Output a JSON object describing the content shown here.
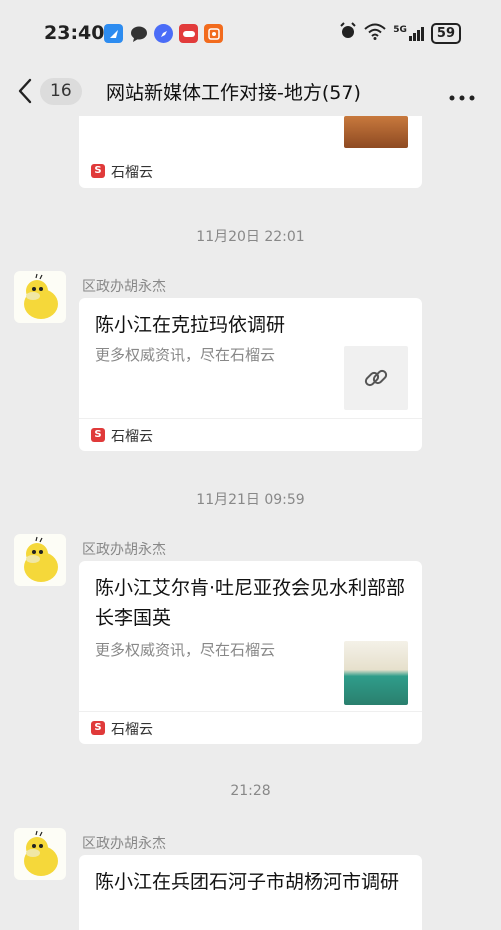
{
  "status_bar": {
    "time": "23:40",
    "battery": "59",
    "network": "5G",
    "app_icons": [
      {
        "name": "maps-icon",
        "color": "#2d8cf0"
      },
      {
        "name": "message-bubble-icon",
        "color": "#333333"
      },
      {
        "name": "compass-icon",
        "color": "#4a6cf7"
      },
      {
        "name": "news-icon",
        "color": "#e23b3b"
      },
      {
        "name": "video-icon",
        "color": "#f26b1d"
      }
    ]
  },
  "header": {
    "back_icon": "chevron-left-icon",
    "unread_count": "16",
    "title": "网站新媒体工作对接-地方(57)",
    "more_icon": "more-dots-icon"
  },
  "messages": [
    {
      "type": "card-partial",
      "source": "石榴云"
    },
    {
      "timestamp": "11月20日 22:01",
      "sender": "区政办胡永杰",
      "title": "陈小江在克拉玛依调研",
      "desc": "更多权威资讯，尽在石榴云",
      "thumb": "link-icon",
      "source": "石榴云"
    },
    {
      "timestamp": "11月21日 09:59",
      "sender": "区政办胡永杰",
      "title": "陈小江艾尔肯·吐尼亚孜会见水利部部长李国英",
      "desc": "更多权威资讯，尽在石榴云",
      "thumb": "meeting-photo",
      "source": "石榴云"
    },
    {
      "timestamp": "21:28",
      "sender": "区政办胡永杰",
      "title": "陈小江在兵团石河子市胡杨河市调研"
    }
  ],
  "colors": {
    "background": "#ececec",
    "card": "#ffffff",
    "source_logo": "#e03a3a",
    "meta_text": "#888888"
  }
}
